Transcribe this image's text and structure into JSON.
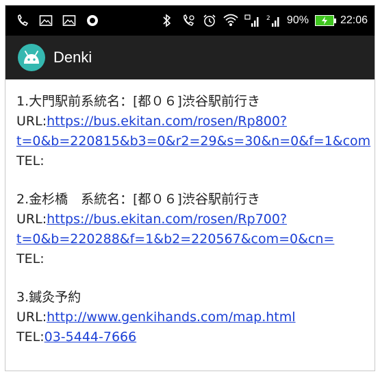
{
  "status_bar": {
    "battery_percent": "90%",
    "time": "22:06",
    "left_icons": [
      "phone-icon",
      "image-icon",
      "image-icon",
      "record-icon"
    ],
    "right_icons": [
      "bluetooth-icon",
      "vibrate-icon",
      "alarm-icon",
      "wifi-icon",
      "signal-icon",
      "signal-icon",
      "battery-charging-icon"
    ],
    "battery_color": "#3fc51f"
  },
  "app_bar": {
    "title": "Denki",
    "background": "#212121",
    "logo_color": "#35b8b0"
  },
  "entries": [
    {
      "title": "1.大門駅前系統名：[都０６]渋谷駅前行き",
      "url_label": "URL:",
      "url_line1": "https://bus.ekitan.com/rosen/Rp800?",
      "url_line2": "t=0&b=220815&b3=0&r2=29&s=30&n=0&f=1&com",
      "tel_label": "TEL:",
      "tel_value": ""
    },
    {
      "title": "2.金杉橋　系統名：[都０６]渋谷駅前行き",
      "url_label": "URL:",
      "url_line1": "https://bus.ekitan.com/rosen/Rp700?",
      "url_line2": "t=0&b=220288&f=1&b2=220567&com=0&cn=",
      "tel_label": "TEL:",
      "tel_value": ""
    },
    {
      "title": "3.鍼灸予約",
      "url_label": "URL:",
      "url_line1": "http://www.genkihands.com/map.html",
      "url_line2": "",
      "tel_label": "TEL:",
      "tel_value": "03-5444-7666"
    }
  ],
  "link_color": "#1a3fd6"
}
